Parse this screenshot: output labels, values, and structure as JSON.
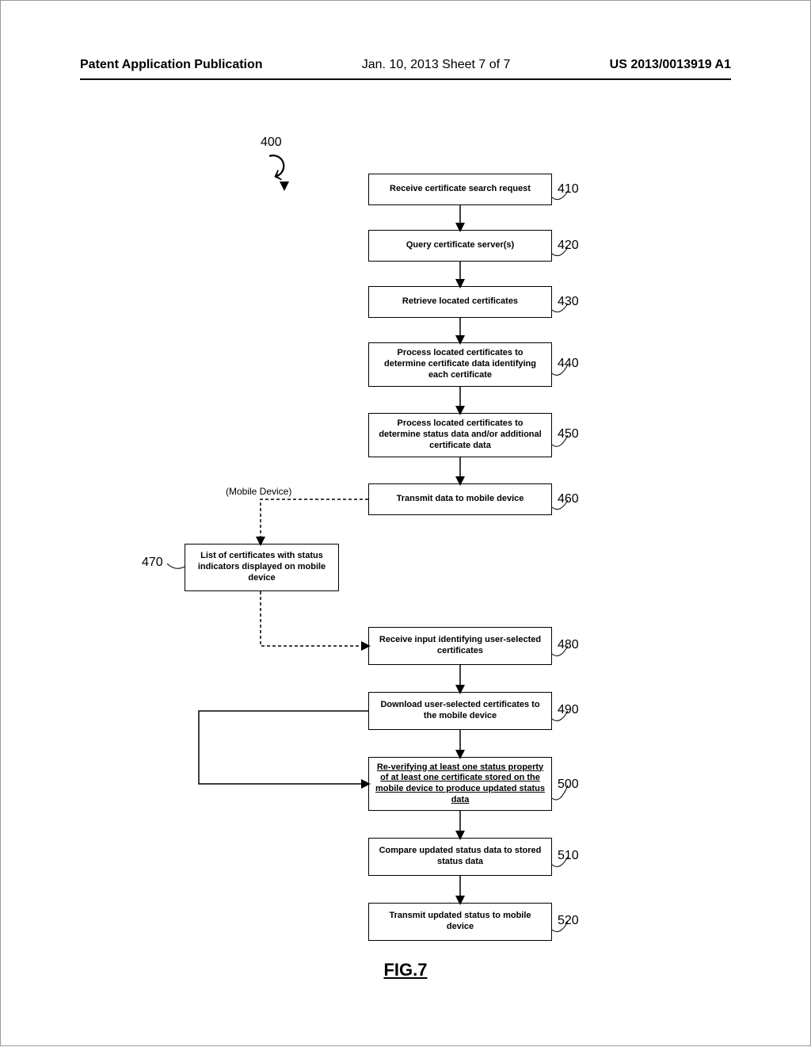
{
  "header": {
    "left": "Patent Application Publication",
    "mid": "Jan. 10, 2013  Sheet 7 of 7",
    "right": "US 2013/0013919 A1"
  },
  "flow": {
    "ref_main": "400",
    "mobile_label": "(Mobile Device)",
    "steps": {
      "s410": {
        "label": "Receive certificate search request",
        "ref": "410"
      },
      "s420": {
        "label": "Query certificate server(s)",
        "ref": "420"
      },
      "s430": {
        "label": "Retrieve located certificates",
        "ref": "430"
      },
      "s440": {
        "label": "Process located certificates to determine certificate data identifying each certificate",
        "ref": "440"
      },
      "s450": {
        "label": "Process located certificates to determine status data and/or additional certificate data",
        "ref": "450"
      },
      "s460": {
        "label": "Transmit data to mobile device",
        "ref": "460"
      },
      "s470": {
        "label": "List of certificates with status indicators displayed on mobile device",
        "ref": "470"
      },
      "s480": {
        "label": "Receive input identifying user-selected certificates",
        "ref": "480"
      },
      "s490": {
        "label": "Download user-selected certificates to the mobile device",
        "ref": "490"
      },
      "s500": {
        "label": "Re-verifying at least one status property of at least one certificate stored on the mobile device to produce updated status data",
        "ref": "500"
      },
      "s510": {
        "label": "Compare updated status data to stored status data",
        "ref": "510"
      },
      "s520": {
        "label": "Transmit updated status to mobile device",
        "ref": "520"
      }
    }
  },
  "figure_label": "FIG.7"
}
